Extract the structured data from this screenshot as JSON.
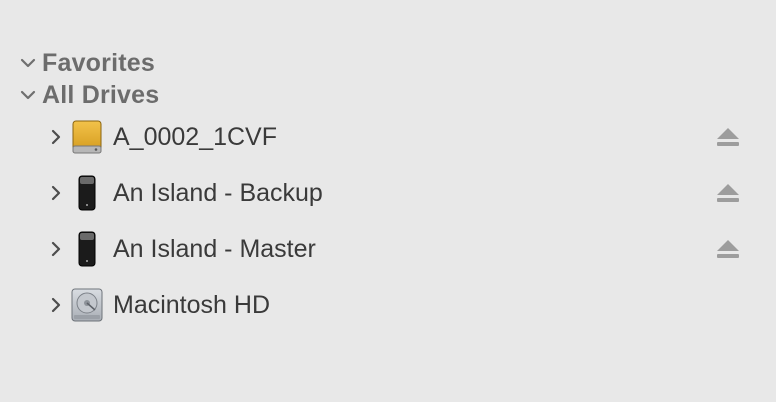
{
  "sidebar": {
    "sections": [
      {
        "label": "Favorites",
        "expanded": true
      },
      {
        "label": "All Drives",
        "expanded": true
      }
    ],
    "drives": [
      {
        "name": "A_0002_1CVF",
        "icon": "external-drive-icon",
        "ejectable": true
      },
      {
        "name": "An Island - Backup",
        "icon": "portable-drive-icon",
        "ejectable": true
      },
      {
        "name": "An Island - Master",
        "icon": "portable-drive-icon",
        "ejectable": true
      },
      {
        "name": "Macintosh HD",
        "icon": "internal-disk-icon",
        "ejectable": false
      }
    ]
  },
  "colors": {
    "background": "#e8e8e8",
    "section_text": "#6c6c6c",
    "item_text": "#3a3a3a",
    "chevron": "#6f6f6f",
    "eject": "#9d9d9d",
    "external_drive": "#e0a92a"
  }
}
